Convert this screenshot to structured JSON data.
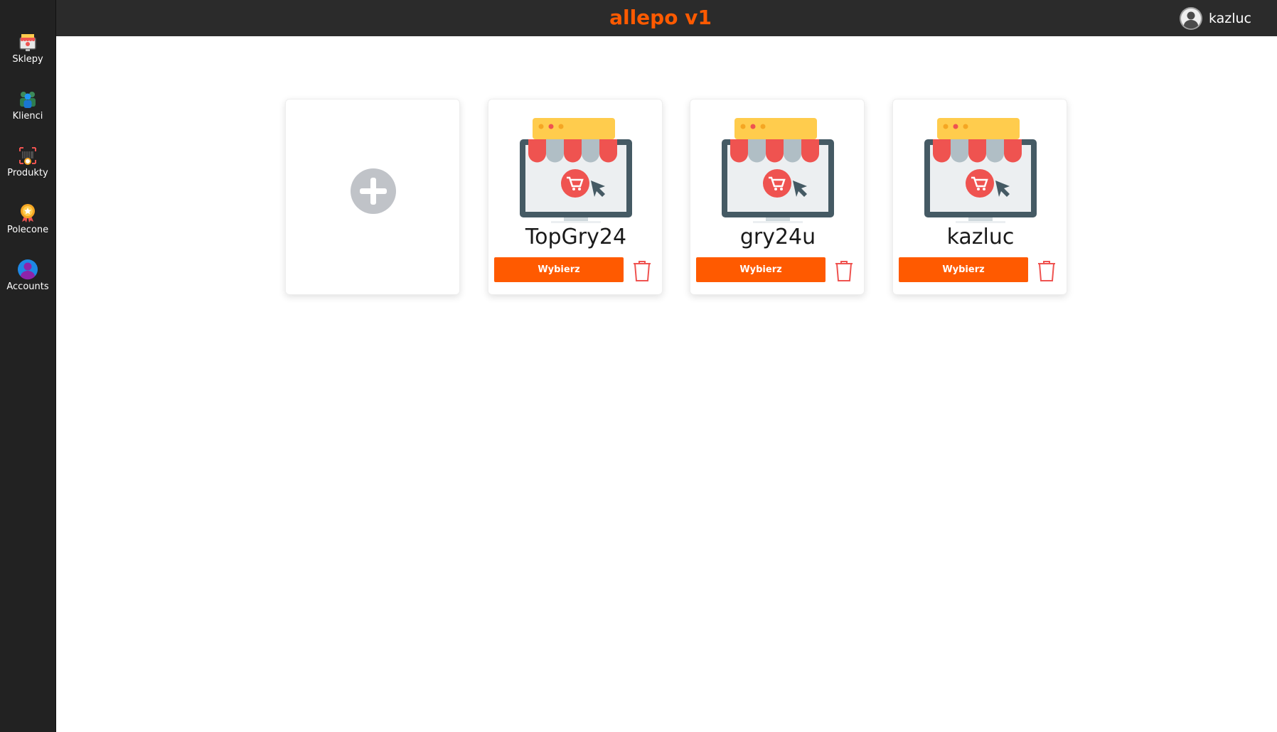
{
  "app": {
    "title": "allepo v1",
    "accent_color": "#ff5a00"
  },
  "header": {
    "user": {
      "icon": "user-avatar-icon",
      "name": "kazluc"
    }
  },
  "sidebar": {
    "items": [
      {
        "label": "Sklepy",
        "icon": "shop-icon"
      },
      {
        "label": "Klienci",
        "icon": "clients-icon"
      },
      {
        "label": "Produkty",
        "icon": "products-icon"
      },
      {
        "label": "Polecone",
        "icon": "recommended-icon"
      },
      {
        "label": "Accounts",
        "icon": "accounts-icon"
      }
    ]
  },
  "shops": {
    "add_card": {
      "icon": "plus-circle-icon"
    },
    "items": [
      {
        "name": "TopGry24",
        "button_label": "Wybierz",
        "icon": "online-shop-icon",
        "delete_icon": "trash-icon"
      },
      {
        "name": "gry24u",
        "button_label": "Wybierz",
        "icon": "online-shop-icon",
        "delete_icon": "trash-icon"
      },
      {
        "name": "kazluc",
        "button_label": "Wybierz",
        "icon": "online-shop-icon",
        "delete_icon": "trash-icon"
      }
    ]
  }
}
